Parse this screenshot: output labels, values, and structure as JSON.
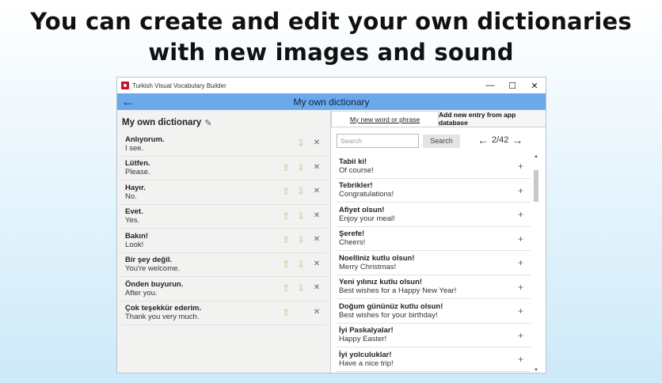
{
  "headline": {
    "line1": "You can create and edit your own dictionaries",
    "line2": "with new images and sound"
  },
  "window": {
    "title": "Turkish Visual Vocabulary Builder",
    "controls": {
      "minimize": "—",
      "maximize": "☐",
      "close": "✕"
    }
  },
  "appbar": {
    "back": "←",
    "title": "My own dictionary"
  },
  "left": {
    "dict_title": "My own dictionary",
    "edit_icon": "✎",
    "entries": [
      {
        "word": "Anlıyorum.",
        "trans": "I see."
      },
      {
        "word": "Lütfen.",
        "trans": "Please."
      },
      {
        "word": "Hayır.",
        "trans": "No."
      },
      {
        "word": "Evet.",
        "trans": "Yes."
      },
      {
        "word": "Bakın!",
        "trans": "Look!"
      },
      {
        "word": "Bir şey değil.",
        "trans": "You're welcome."
      },
      {
        "word": "Önden buyurun.",
        "trans": "After you."
      },
      {
        "word": "Çok teşekkür ederim.",
        "trans": "Thank you very much."
      }
    ],
    "icons": {
      "up": "⇧",
      "down": "⇩",
      "remove": "✕"
    }
  },
  "right": {
    "tab_own": "My new word or phrase",
    "tab_db": "Add new entry from app database",
    "search_placeholder": "Search",
    "search_button": "Search",
    "pager": {
      "prev": "←",
      "label": "2/42",
      "next": "→"
    },
    "add_icon": "+",
    "items": [
      {
        "word": "Tabii ki!",
        "trans": "Of course!"
      },
      {
        "word": "Tebrikler!",
        "trans": "Congratulations!"
      },
      {
        "word": "Afiyet olsun!",
        "trans": "Enjoy your meal!"
      },
      {
        "word": "Şerefe!",
        "trans": "Cheers!"
      },
      {
        "word": "Noelliniz kutlu olsun!",
        "trans": "Merry Christmas!"
      },
      {
        "word": "Yeni yılınız kutlu olsun!",
        "trans": "Best wishes for a Happy New Year!"
      },
      {
        "word": "Doğum gününüz kutlu olsun!",
        "trans": "Best wishes for your birthday!"
      },
      {
        "word": "İyi Paskalyalar!",
        "trans": "Happy Easter!"
      },
      {
        "word": "İyi yolculuklar!",
        "trans": "Have a nice trip!"
      }
    ]
  },
  "colors": {
    "appbar": "#6aa9ec",
    "arrows": "#9ed07c"
  }
}
